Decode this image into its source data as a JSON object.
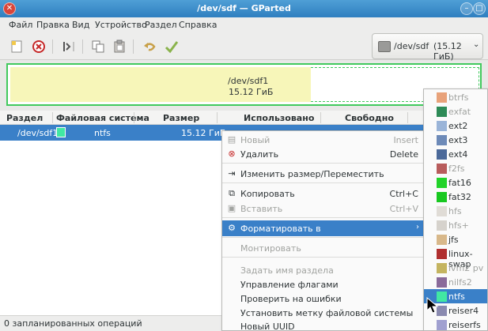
{
  "window": {
    "title": "/dev/sdf — GParted"
  },
  "menubar": [
    "Файл",
    "Правка",
    "Вид",
    "Устройство",
    "Раздел",
    "Справка"
  ],
  "toolbar": {
    "icons": [
      "new-icon",
      "delete-icon",
      "resize-icon",
      "copy-icon",
      "paste-icon",
      "undo-icon",
      "apply-icon"
    ]
  },
  "device_selector": {
    "device": "/dev/sdf",
    "size": "(15.12 ГиБ)"
  },
  "disk_map": {
    "partition": "/dev/sdf1",
    "size": "15.12 ГиБ",
    "used_fraction": 0.64
  },
  "table": {
    "columns": [
      "Раздел",
      "Файловая система",
      "Размер",
      "Использовано",
      "Свободно"
    ],
    "rows": [
      {
        "partition": "/dev/sdf1",
        "filesystem": "ntfs",
        "size": "15.12 ГиБ",
        "fs_color": "#41e8a3"
      }
    ]
  },
  "status": {
    "text": "0 запланированных операций"
  },
  "context_menu": {
    "items": [
      {
        "label": "Новый",
        "shortcut": "Insert",
        "disabled": true,
        "icon": "new-icon"
      },
      {
        "label": "Удалить",
        "shortcut": "Delete",
        "disabled": false,
        "icon": "delete-icon"
      },
      {
        "label": "Изменить размер/Переместить",
        "shortcut": "",
        "disabled": false,
        "icon": "resize-icon"
      },
      {
        "label": "Копировать",
        "shortcut": "Ctrl+C",
        "disabled": false,
        "icon": "copy-icon"
      },
      {
        "label": "Вставить",
        "shortcut": "Ctrl+V",
        "disabled": true,
        "icon": "paste-icon"
      },
      {
        "label": "Форматировать в",
        "shortcut": "",
        "disabled": false,
        "icon": "format-icon",
        "highlighted": true
      },
      {
        "label": "Монтировать",
        "shortcut": "",
        "disabled": true,
        "icon": ""
      },
      {
        "label": "Задать имя раздела",
        "shortcut": "",
        "disabled": true,
        "icon": ""
      },
      {
        "label": "Управление флагами",
        "shortcut": "",
        "disabled": false,
        "icon": ""
      },
      {
        "label": "Проверить на ошибки",
        "shortcut": "",
        "disabled": false,
        "icon": ""
      },
      {
        "label": "Установить метку файловой системы",
        "shortcut": "",
        "disabled": false,
        "icon": ""
      },
      {
        "label": "Новый UUID",
        "shortcut": "",
        "disabled": false,
        "icon": ""
      }
    ]
  },
  "format_submenu": {
    "items": [
      {
        "name": "btrfs",
        "color": "#e8a27a",
        "disabled": true
      },
      {
        "name": "exfat",
        "color": "#2e8b57",
        "disabled": true
      },
      {
        "name": "ext2",
        "color": "#9ab4d8",
        "disabled": false
      },
      {
        "name": "ext3",
        "color": "#6d8ab8",
        "disabled": false
      },
      {
        "name": "ext4",
        "color": "#4c6a9a",
        "disabled": false
      },
      {
        "name": "f2fs",
        "color": "#b85c5c",
        "disabled": true
      },
      {
        "name": "fat16",
        "color": "#22d32a",
        "disabled": false
      },
      {
        "name": "fat32",
        "color": "#18c820",
        "disabled": false
      },
      {
        "name": "hfs",
        "color": "#e0dcd6",
        "disabled": true
      },
      {
        "name": "hfs+",
        "color": "#d6d2cc",
        "disabled": true
      },
      {
        "name": "jfs",
        "color": "#d8b88a",
        "disabled": false
      },
      {
        "name": "linux-swap",
        "color": "#b03030",
        "disabled": false
      },
      {
        "name": "lvm2 pv",
        "color": "#c4b460",
        "disabled": true
      },
      {
        "name": "nilfs2",
        "color": "#8a6a9a",
        "disabled": true
      },
      {
        "name": "ntfs",
        "color": "#41e8a3",
        "disabled": false,
        "highlighted": true
      },
      {
        "name": "reiser4",
        "color": "#8a8ab0",
        "disabled": false
      },
      {
        "name": "reiserfs",
        "color": "#a0a0d0",
        "disabled": false
      }
    ]
  }
}
